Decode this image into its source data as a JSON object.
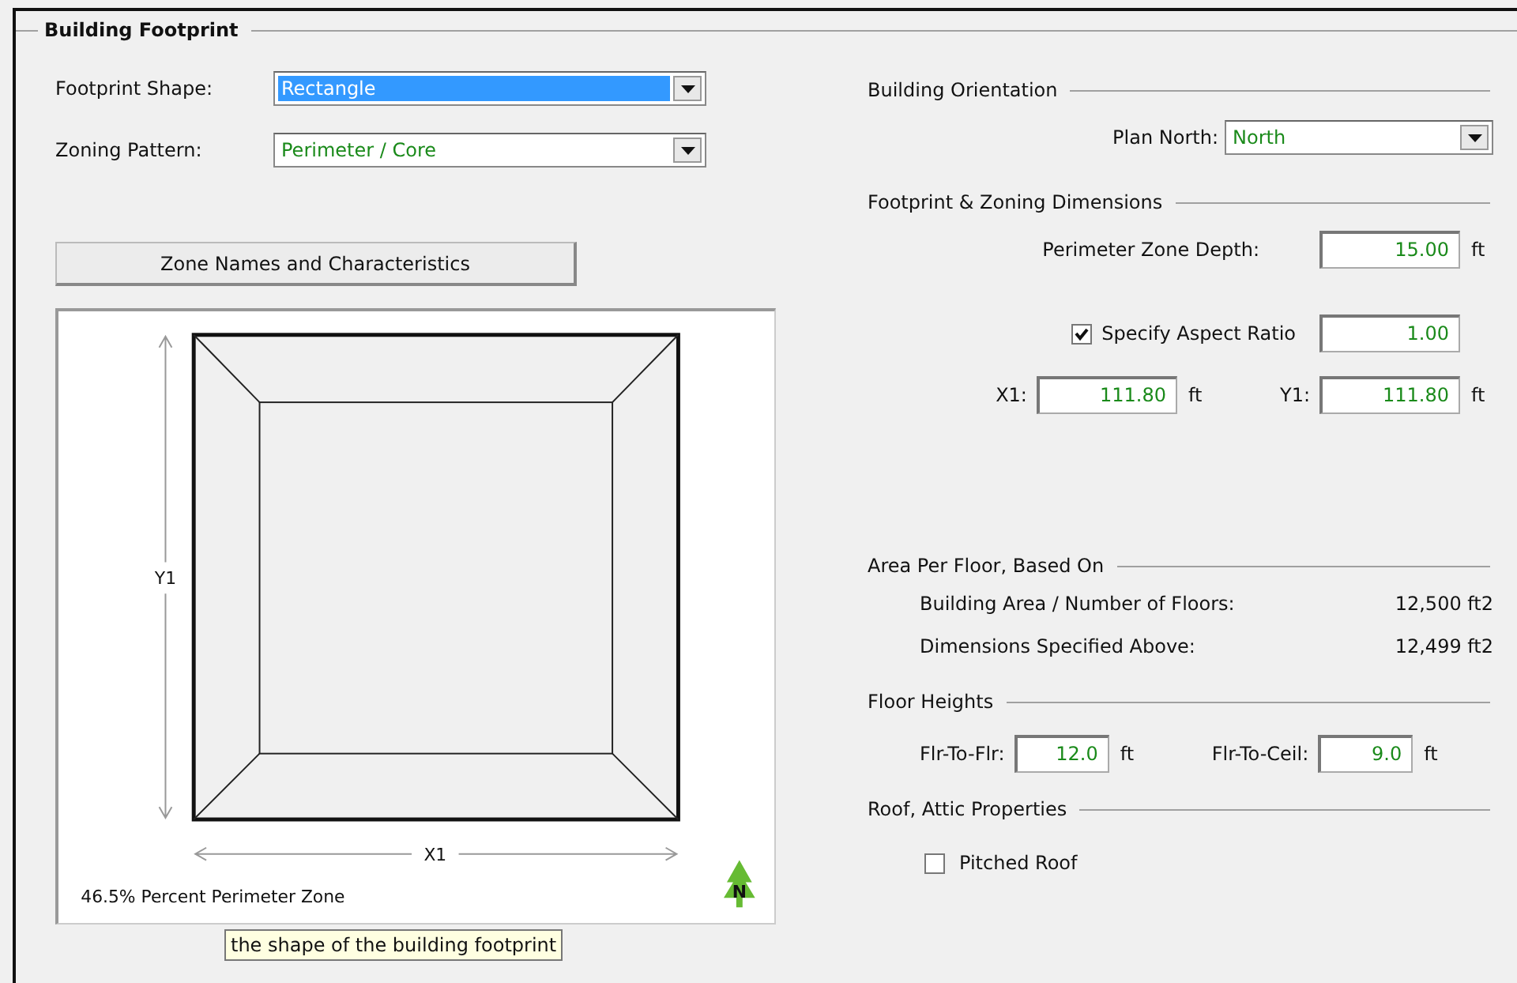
{
  "group": {
    "title": "Building Footprint"
  },
  "left": {
    "fields": [
      {
        "label": "Footprint Shape:",
        "value": "Rectangle",
        "focused": true
      },
      {
        "label": "Zoning Pattern:",
        "value": "Perimeter / Core",
        "focused": false
      }
    ],
    "button": "Zone Names and Characteristics",
    "diagram": {
      "y_label": "Y1",
      "x_label": "X1",
      "perimeter_note": "46.5% Percent Perimeter Zone",
      "north_label": "N"
    },
    "tooltip": "the shape of the building footprint"
  },
  "orientation": {
    "title": "Building Orientation",
    "plan_north": {
      "label": "Plan North:",
      "value": "North"
    }
  },
  "dimensions": {
    "title": "Footprint & Zoning Dimensions",
    "depth": {
      "label": "Perimeter Zone Depth:",
      "value": "15.00",
      "unit": "ft"
    },
    "aspect": {
      "label": "Specify Aspect Ratio",
      "checked": true,
      "value": "1.00"
    },
    "x1": {
      "label": "X1:",
      "value": "111.80",
      "unit": "ft"
    },
    "y1": {
      "label": "Y1:",
      "value": "111.80",
      "unit": "ft"
    }
  },
  "area": {
    "title": "Area Per Floor, Based On",
    "rows": [
      {
        "label": "Building Area / Number of Floors:",
        "value": "12,500 ft2"
      },
      {
        "label": "Dimensions Specified Above:",
        "value": "12,499 ft2"
      }
    ]
  },
  "heights": {
    "title": "Floor Heights",
    "fields": [
      {
        "label": "Flr-To-Flr:",
        "value": "12.0",
        "unit": "ft"
      },
      {
        "label": "Flr-To-Ceil:",
        "value": "9.0",
        "unit": "ft"
      }
    ]
  },
  "roof": {
    "title": "Roof, Attic Properties",
    "pitched": {
      "label": "Pitched Roof",
      "checked": false
    }
  }
}
